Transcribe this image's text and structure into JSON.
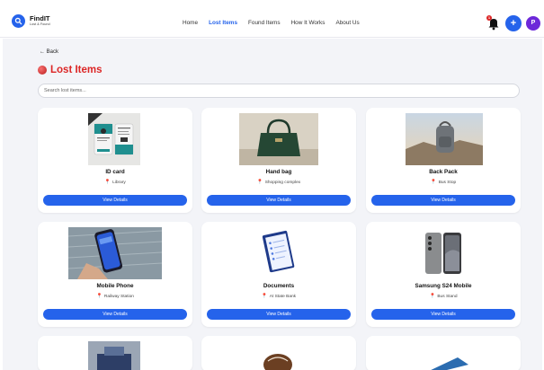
{
  "header": {
    "app_title": "FindIT",
    "app_subtitle": "Lost & Found",
    "nav": [
      "Home",
      "Lost Items",
      "Found Items",
      "How It Works",
      "About Us"
    ],
    "active_nav": "Lost Items",
    "notification_count": "1",
    "add_label": "+",
    "avatar_initial": "P"
  },
  "page": {
    "back_label": "← Back",
    "title": "Lost Items",
    "search_placeholder": "Search lost items..."
  },
  "items": [
    {
      "name": "ID card",
      "location": "Library",
      "button": "View Details"
    },
    {
      "name": "Hand bag",
      "location": "Shopping complex",
      "button": "View Details"
    },
    {
      "name": "Back Pack",
      "location": "Bus Stop",
      "button": "View Details"
    },
    {
      "name": "Mobile Phone",
      "location": "Railway Station",
      "button": "View Details"
    },
    {
      "name": "Documents",
      "location": "At State Bank",
      "button": "View Details"
    },
    {
      "name": "Samsung S24 Mobile",
      "location": "Bus Stand",
      "button": "View Details"
    }
  ],
  "colors": {
    "accent": "#2563eb",
    "title_red": "#dc2626",
    "avatar": "#6d28d9"
  }
}
